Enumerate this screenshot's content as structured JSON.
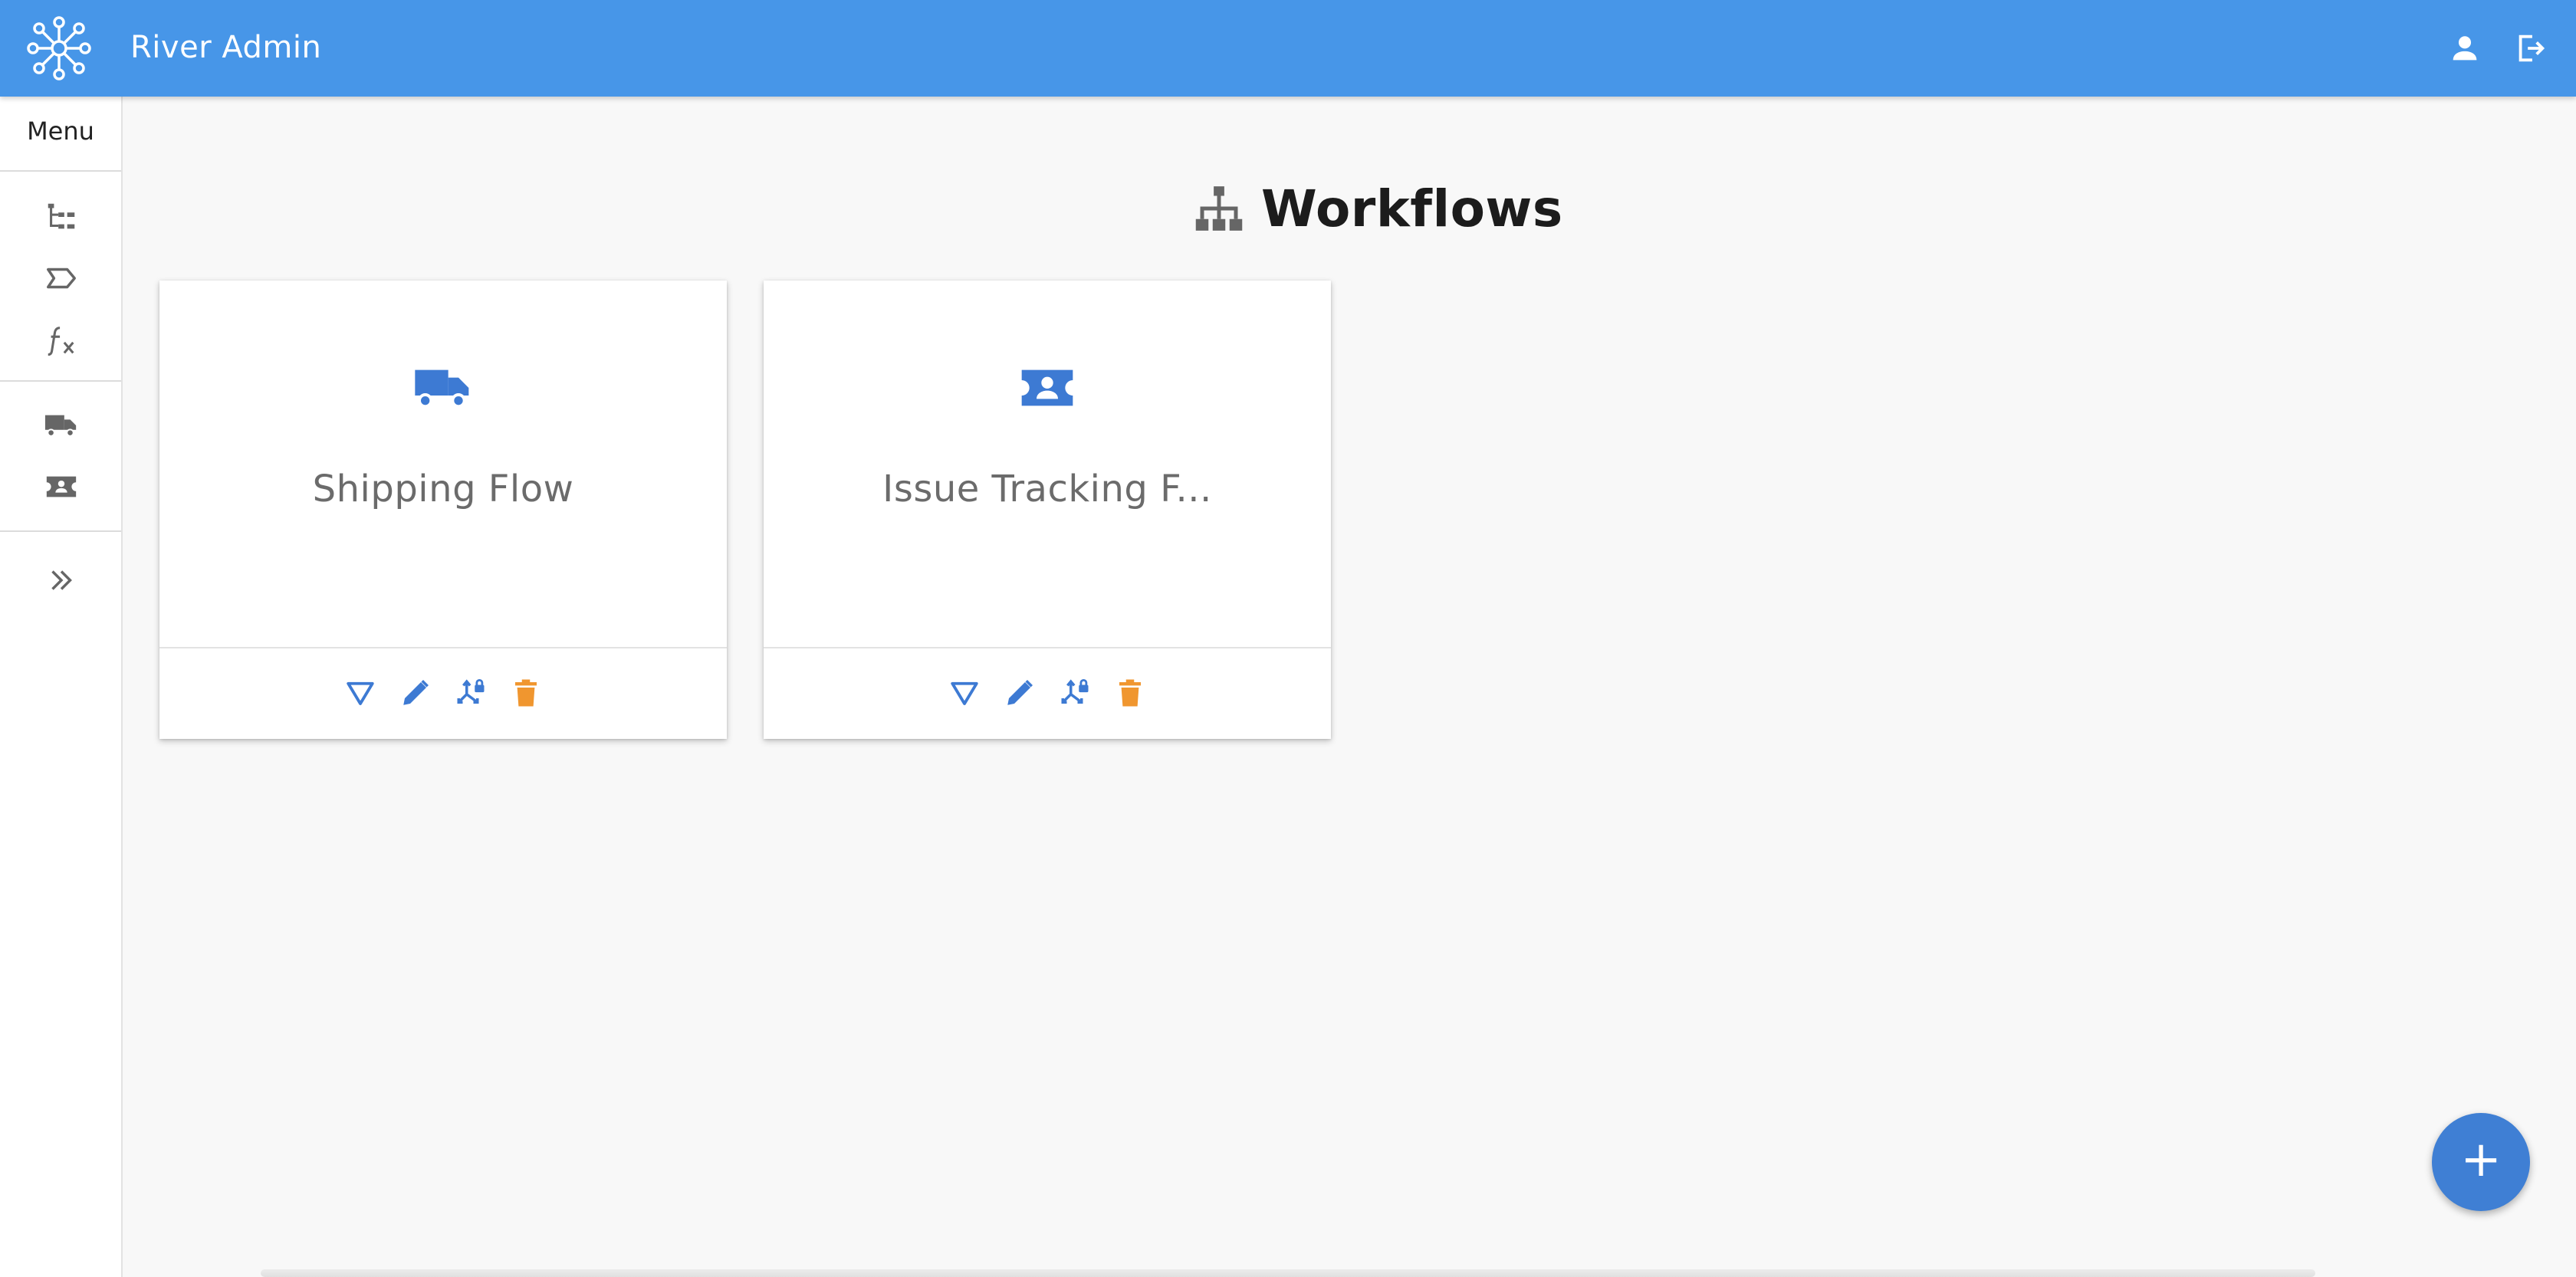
{
  "app": {
    "title": "River Admin"
  },
  "colors": {
    "primary": "#4796e8",
    "accent_blue": "#3d7ad3",
    "accent_orange": "#f0962f",
    "icon_gray": "#666666"
  },
  "topbar": {
    "icons": [
      "user-icon",
      "logout-icon"
    ]
  },
  "sidebar": {
    "menu_label": "Menu",
    "groups": [
      [
        "hierarchy-list-icon",
        "state-tag-icon",
        "function-icon"
      ],
      [
        "truck-icon",
        "ticket-icon"
      ],
      [
        "double-chevron-right-icon"
      ]
    ]
  },
  "page": {
    "title": "Workflows",
    "title_icon": "sitemap-icon"
  },
  "workflows": [
    {
      "name": "Shipping Flow",
      "icon": "truck-icon",
      "actions": [
        "filter-icon",
        "edit-icon",
        "permissions-icon",
        "delete-icon"
      ]
    },
    {
      "name": "Issue Tracking F...",
      "icon": "ticket-icon",
      "actions": [
        "filter-icon",
        "edit-icon",
        "permissions-icon",
        "delete-icon"
      ]
    }
  ],
  "fab": {
    "label": "+"
  }
}
